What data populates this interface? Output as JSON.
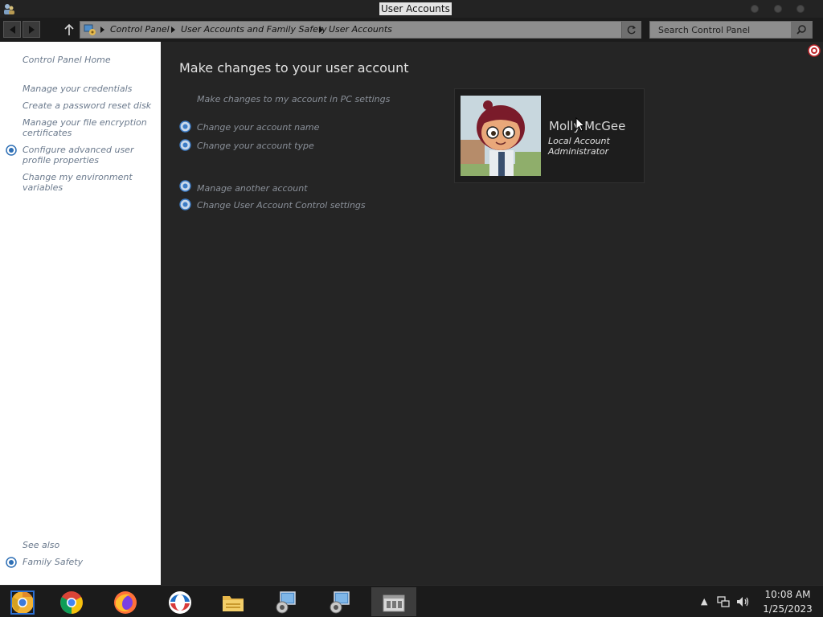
{
  "window": {
    "title": "User Accounts"
  },
  "address": {
    "breadcrumbs": [
      "Control Panel",
      "User Accounts and Family Safety",
      "User Accounts"
    ]
  },
  "search": {
    "placeholder": "Search Control Panel"
  },
  "sidebar": {
    "home": "Control Panel Home",
    "items": [
      {
        "label": "Manage your credentials",
        "icon": null
      },
      {
        "label": "Create a password reset disk",
        "icon": null
      },
      {
        "label": "Manage your file encryption certificates",
        "icon": null
      },
      {
        "label": "Configure advanced user profile properties",
        "icon": "shield-icon"
      },
      {
        "label": "Change my environment variables",
        "icon": null
      }
    ],
    "see_also": "See also",
    "family_safety": "Family Safety"
  },
  "main": {
    "title": "Make changes to your user account",
    "pc_settings": "Make changes to my account in PC settings",
    "actions": [
      {
        "label": "Change your account name",
        "icon": "shield-icon"
      },
      {
        "label": "Change your account type",
        "icon": "shield-icon"
      }
    ],
    "more_actions": [
      {
        "label": "Manage another account",
        "icon": "shield-icon"
      },
      {
        "label": "Change User Account Control settings",
        "icon": "shield-icon"
      }
    ]
  },
  "user": {
    "name": "Molly McGee",
    "account_type": "Local Account",
    "role": "Administrator"
  },
  "taskbar": {
    "apps": [
      "chrome-canary",
      "chrome",
      "firefox",
      "opera",
      "file-explorer",
      "control-panel",
      "control-panel-2",
      "window-switcher"
    ]
  },
  "clock": {
    "time": "10:08 AM",
    "date": "1/25/2023"
  },
  "colors": {
    "link": "#6b7a8d",
    "main_bg": "#252525",
    "sidebar_bg": "#ffffff"
  }
}
